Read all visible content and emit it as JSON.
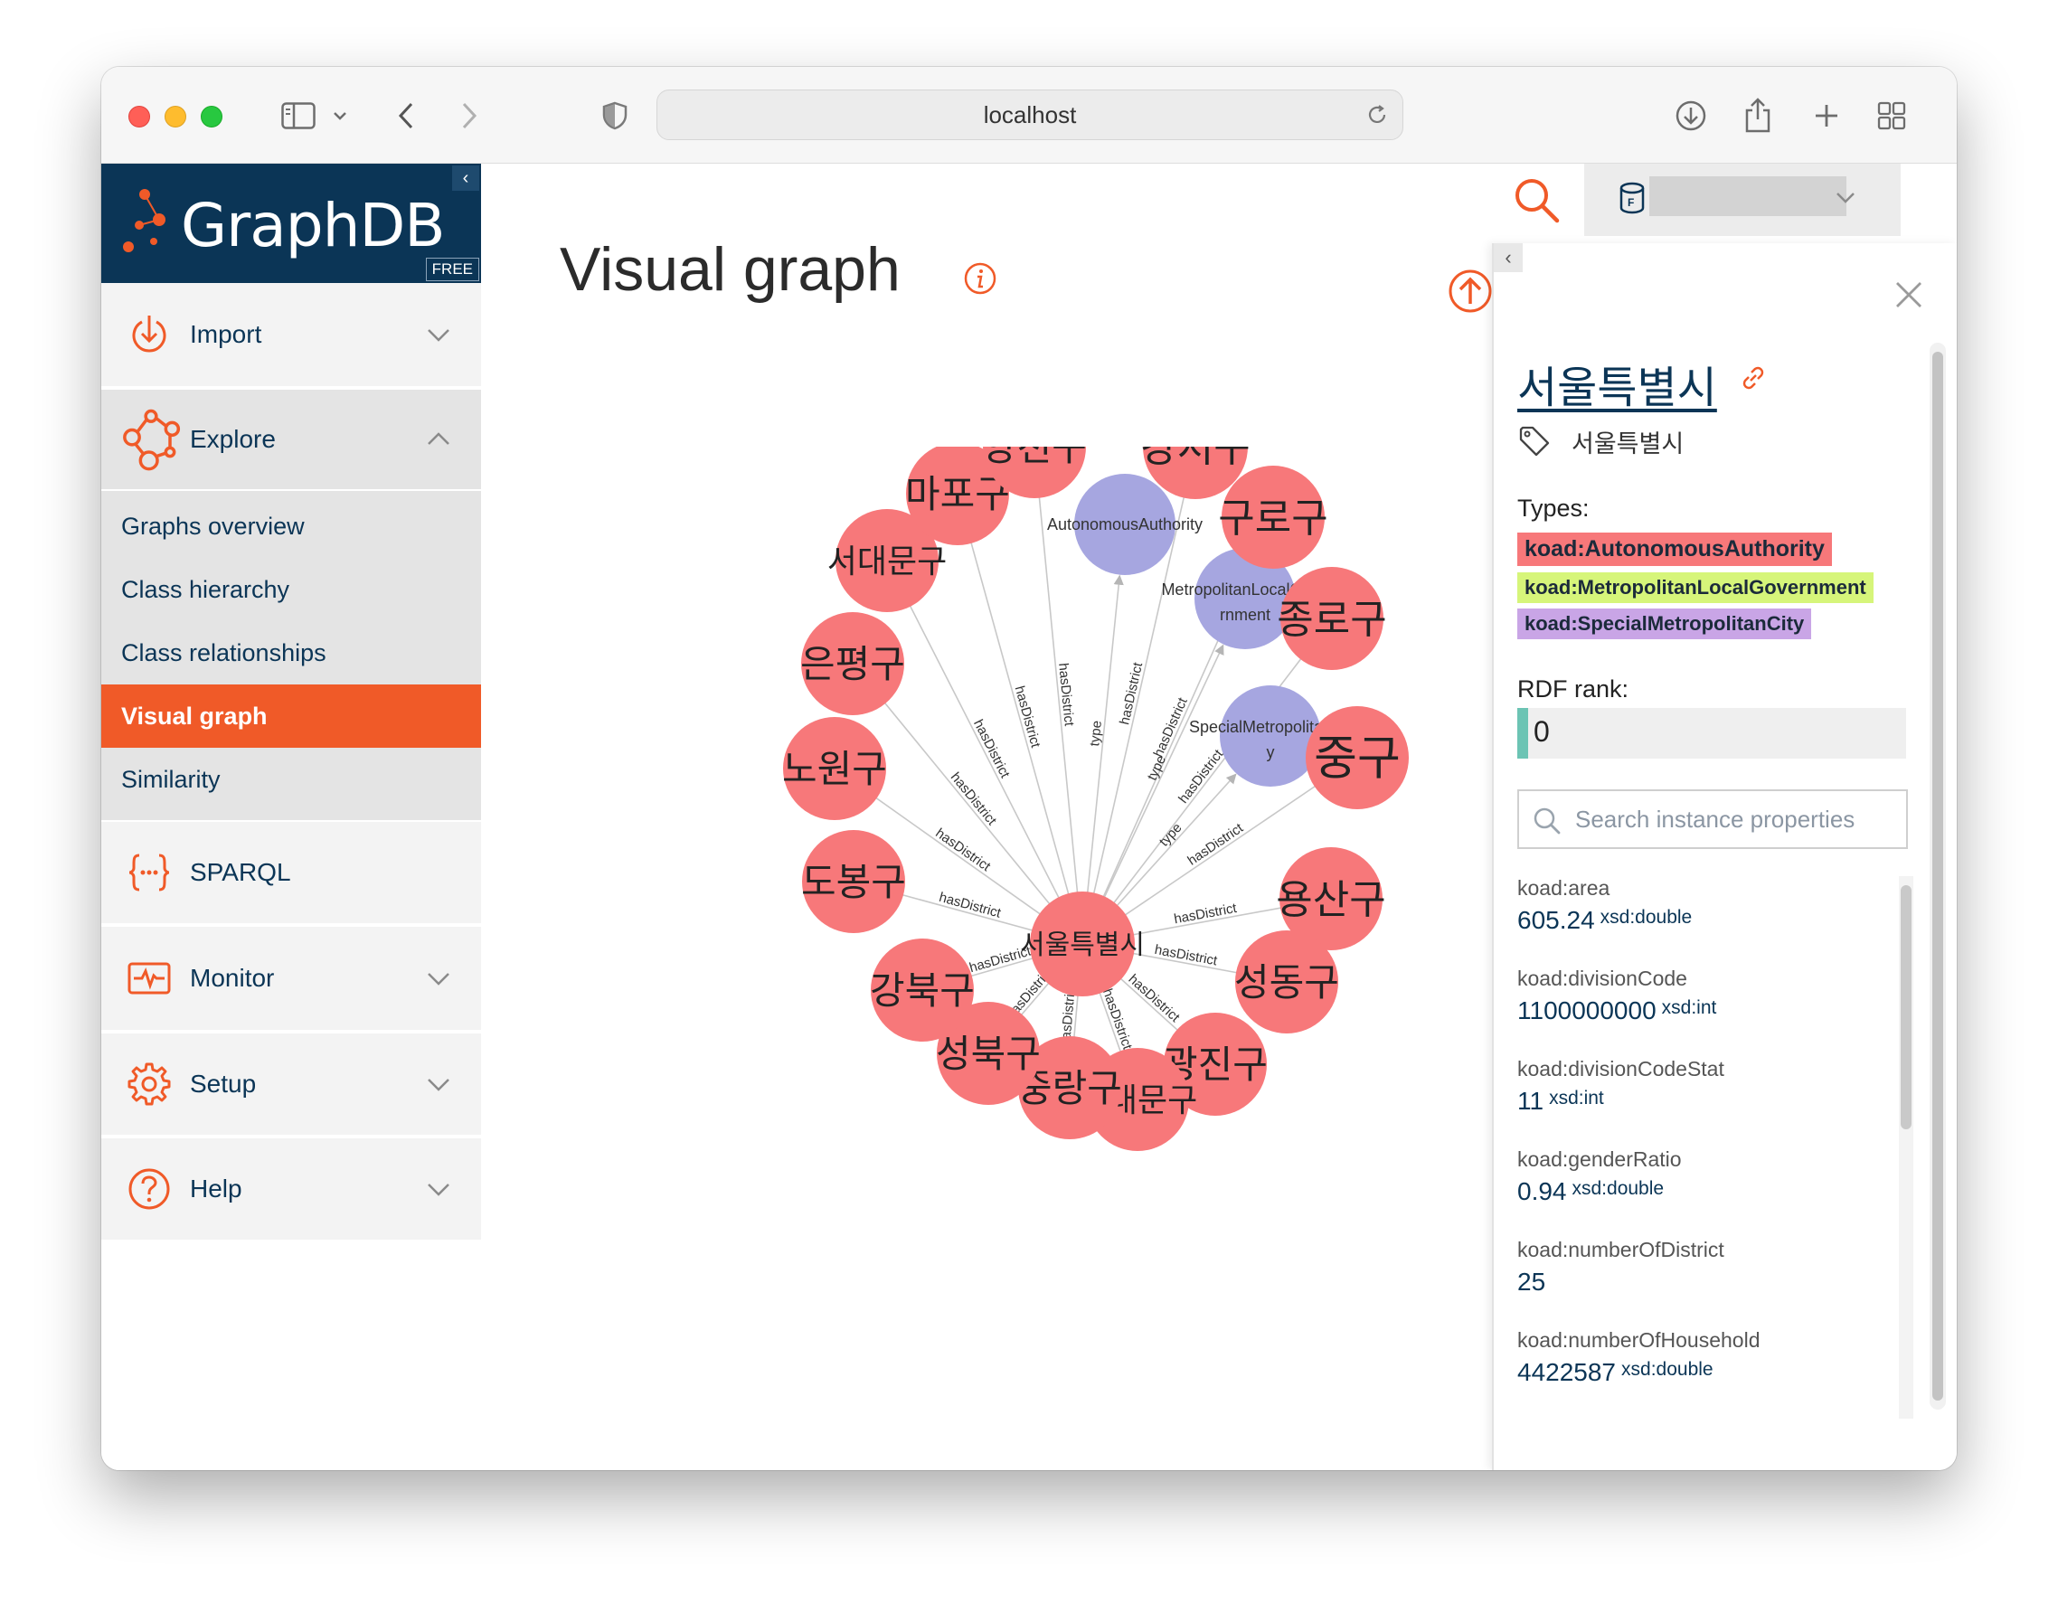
{
  "browser": {
    "url": "localhost"
  },
  "app": {
    "logo_text": "GraphDB",
    "edition_badge": "FREE",
    "collapse_glyph": "‹"
  },
  "sidebar": {
    "import_label": "Import",
    "explore_label": "Explore",
    "explore_items": [
      {
        "label": "Graphs overview"
      },
      {
        "label": "Class hierarchy"
      },
      {
        "label": "Class relationships"
      },
      {
        "label": "Visual graph"
      },
      {
        "label": "Similarity"
      }
    ],
    "sparql_label": "SPARQL",
    "monitor_label": "Monitor",
    "setup_label": "Setup",
    "help_label": "Help"
  },
  "main": {
    "title": "Visual graph"
  },
  "graph": {
    "center": "서울특별시",
    "type_nodes": [
      "AutonomousAuthority",
      "MetropolitanLocalGove rnment",
      "SpecialMetropolitanCit y"
    ],
    "edge_label_type": "type",
    "edge_label_district": "hasDistrict",
    "districts": [
      "강서구",
      "구로구",
      "종로구",
      "중구",
      "용산구",
      "성동구",
      "광진구",
      "동대문구",
      "중랑구",
      "성북구",
      "강북구",
      "도봉구",
      "노원구",
      "은평구",
      "서대문구",
      "마포구",
      "양천구"
    ],
    "colors": {
      "district_node": "#f7787a",
      "type_node": "#a6a6e0",
      "edge": "#c8c8c8"
    }
  },
  "panel": {
    "collapse_glyph": "‹",
    "title": "서울특별시",
    "label": "서울특별시",
    "types_heading": "Types:",
    "types": [
      {
        "name": "koad:AutonomousAuthority",
        "color": "#f7787a"
      },
      {
        "name": "koad:MetropolitanLocalGovernment",
        "color": "#d6f57a"
      },
      {
        "name": "koad:SpecialMetropolitanCity",
        "color": "#c9a5e6"
      }
    ],
    "rank_heading": "RDF rank:",
    "rank_value": "0",
    "search_placeholder": "Search instance properties",
    "properties": [
      {
        "name": "koad:area",
        "value": "605.24",
        "type": "xsd:double"
      },
      {
        "name": "koad:divisionCode",
        "value": "1100000000",
        "type": "xsd:int"
      },
      {
        "name": "koad:divisionCodeStat",
        "value": "11",
        "type": "xsd:int"
      },
      {
        "name": "koad:genderRatio",
        "value": "0.94",
        "type": "xsd:double"
      },
      {
        "name": "koad:numberOfDistrict",
        "value": "25",
        "type": ""
      },
      {
        "name": "koad:numberOfHousehold",
        "value": "4422587",
        "type": "xsd:double"
      }
    ]
  }
}
